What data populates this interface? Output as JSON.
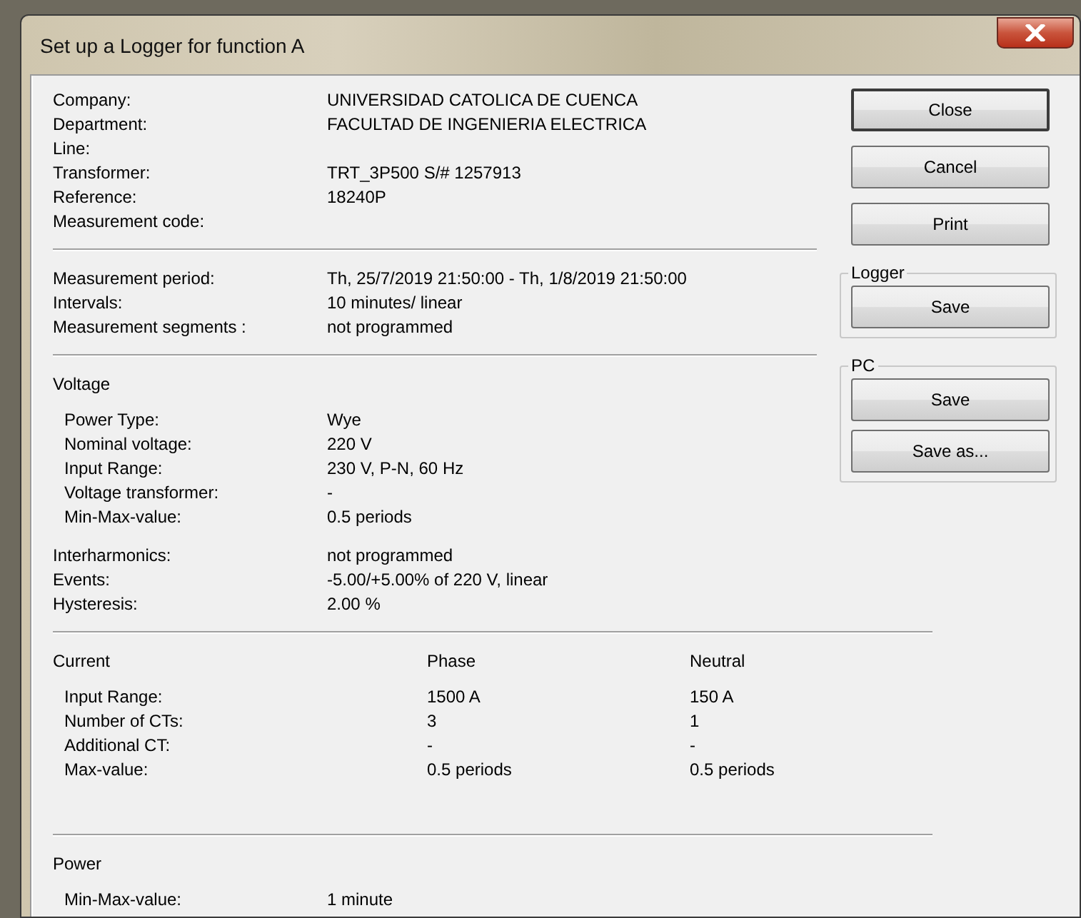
{
  "window": {
    "title": "Set up a Logger for function A"
  },
  "sections": [
    {
      "kind": "fields",
      "rows": [
        {
          "label": "Company:",
          "value": "UNIVERSIDAD CATOLICA DE CUENCA"
        },
        {
          "label": "Department:",
          "value": "FACULTAD DE INGENIERIA ELECTRICA"
        },
        {
          "label": "Line:"
        },
        {
          "label": "Transformer:",
          "value": "TRT_3P500  S/# 1257913"
        },
        {
          "label": "Reference:",
          "value": "18240P"
        },
        {
          "label": "Measurement code:"
        }
      ]
    },
    {
      "kind": "fields",
      "rows": [
        {
          "label": "Measurement period:",
          "value": "Th, 25/7/2019 21:50:00 - Th, 1/8/2019 21:50:00"
        },
        {
          "label": "Intervals:",
          "value": "10 minutes/ linear"
        },
        {
          "label": "Measurement segments :",
          "value": "not programmed"
        }
      ]
    },
    {
      "kind": "group",
      "title": "Voltage",
      "rows": [
        {
          "label": "Power Type:",
          "value": "Wye"
        },
        {
          "label": "Nominal voltage:",
          "value": "220 V"
        },
        {
          "label": "Input Range:",
          "value": "230 V, P-N, 60 Hz"
        },
        {
          "label": "Voltage transformer:",
          "value": "-"
        },
        {
          "label": "Min-Max-value:",
          "value": "0.5 periods"
        }
      ],
      "extra": [
        {
          "label": "Interharmonics:",
          "value": "not programmed"
        },
        {
          "label": "Events:",
          "value": "-5.00/+5.00% of 220 V, linear"
        },
        {
          "label": "Hysteresis:",
          "value": "2.00 %"
        }
      ]
    },
    {
      "kind": "table",
      "title": "Current",
      "columns": [
        "Phase",
        "Neutral"
      ],
      "rows": [
        {
          "label": "Input Range:",
          "values": [
            "1500 A",
            "150 A"
          ]
        },
        {
          "label": "Number of CTs:",
          "values": [
            "3",
            "1"
          ]
        },
        {
          "label": "Additional CT:",
          "values": [
            "-",
            "-"
          ]
        },
        {
          "label": "Max-value:",
          "values": [
            "0.5 periods",
            "0.5 periods"
          ]
        }
      ]
    },
    {
      "kind": "group",
      "title": "Power",
      "rows": [
        {
          "label": "Min-Max-value:",
          "value": "1 minute"
        }
      ]
    }
  ],
  "buttons": [
    {
      "label": "Close",
      "default": true
    },
    {
      "label": "Cancel",
      "default": false
    },
    {
      "label": "Print",
      "default": false
    }
  ],
  "button_groups": [
    {
      "title": "Logger",
      "buttons": [
        "Save"
      ]
    },
    {
      "title": "PC",
      "buttons": [
        "Save",
        "Save as..."
      ]
    }
  ]
}
